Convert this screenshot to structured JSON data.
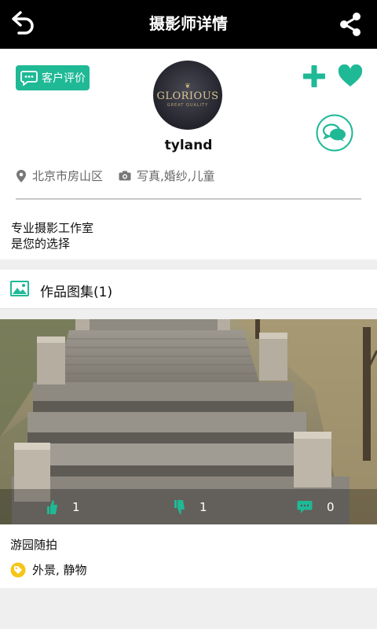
{
  "header": {
    "title": "摄影师详情",
    "back_icon": "back-arrow-icon",
    "share_icon": "share-icon"
  },
  "profile": {
    "review_label": "客户评价",
    "avatar": {
      "logo": "GLORIOUS",
      "tagline": "GREAT QUALITY"
    },
    "username": "tyland",
    "location": "北京市房山区",
    "specialties": "写真,婚纱,儿童",
    "description": [
      "专业摄影工作室",
      "是您的选择"
    ]
  },
  "gallery": {
    "title": "作品图集(1)",
    "items": [
      {
        "title": "游园随拍",
        "tags": "外景, 静物",
        "likes": "1",
        "dislikes": "1",
        "comments": "0"
      }
    ]
  },
  "colors": {
    "accent": "#1fb996",
    "topbar": "#000000",
    "tag": "#f5c518"
  }
}
